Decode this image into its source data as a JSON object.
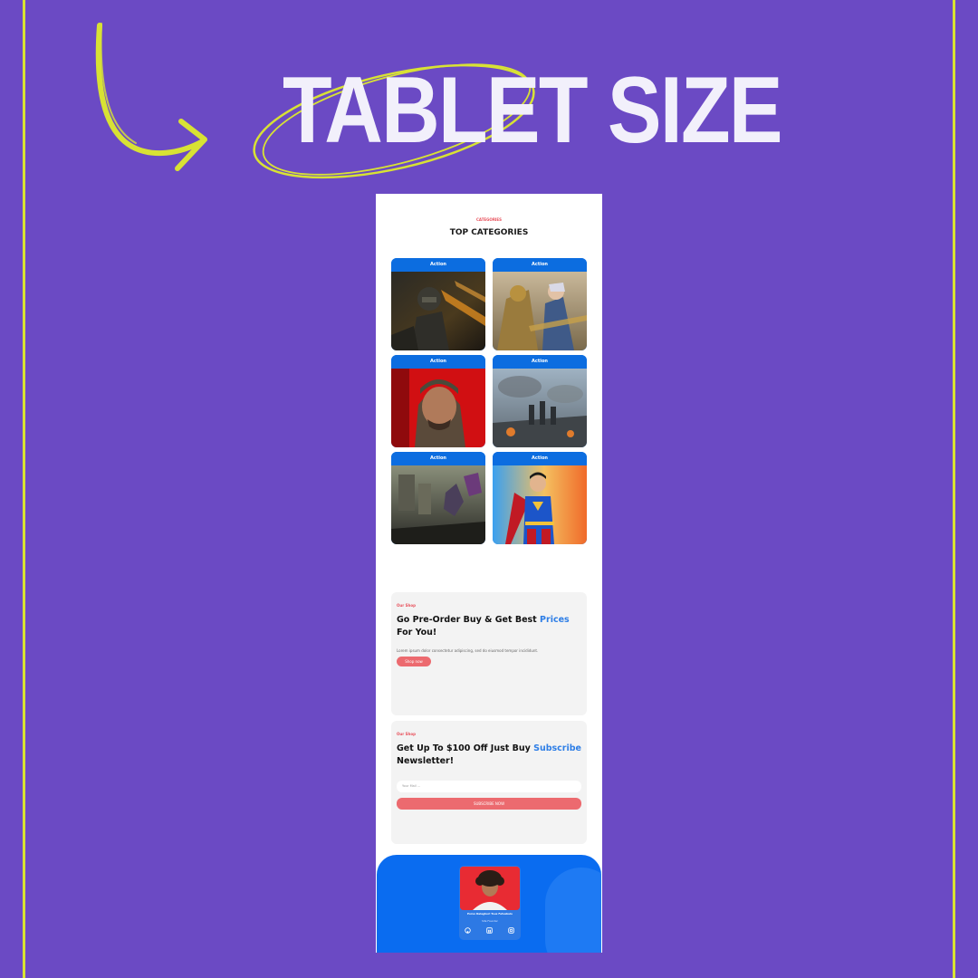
{
  "headline": "TABLET SIZE",
  "categories": {
    "eyebrow": "CATEGORIES",
    "title": "TOP CATEGORIES",
    "cards": [
      {
        "tag": "Action",
        "image": "soldier-night-art"
      },
      {
        "tag": "Action",
        "image": "armored-heroine-art"
      },
      {
        "tag": "Action",
        "image": "soldier-red-portrait-art"
      },
      {
        "tag": "Action",
        "image": "battlefield-squad-art"
      },
      {
        "tag": "Action",
        "image": "ruined-city-battle-art"
      },
      {
        "tag": "Action",
        "image": "superhero-art"
      }
    ]
  },
  "promo1": {
    "kicker": "Our Shop",
    "title_prefix": "Go Pre-Order Buy & Get Best ",
    "title_highlight": "Prices",
    "title_suffix": " For You!",
    "description": "Lorem ipsum dolor consectetur adipiscing, sed do eiusmod tempor incididunt.",
    "button": "Shop now"
  },
  "promo2": {
    "kicker": "Our Shop",
    "title_prefix": "Get Up To $100 Off Just Buy ",
    "title_highlight": "Subscribe",
    "title_suffix": " Newsletter!",
    "email_placeholder": "Your Mail ...",
    "button": "SUBSCRIBE NOW"
  },
  "footer": {
    "name": "Porus Dalaghori Tous Futusbulo",
    "role": "Site Founder",
    "social": [
      "github-icon",
      "linkedin-icon",
      "instagram-icon"
    ]
  },
  "colors": {
    "background": "#6b4ac4",
    "accent_line": "#d8e234",
    "tag_blue": "#0c6de0",
    "highlight": "#2e7ee6",
    "button": "#ec6a6f",
    "footer": "#0a6cf0"
  }
}
